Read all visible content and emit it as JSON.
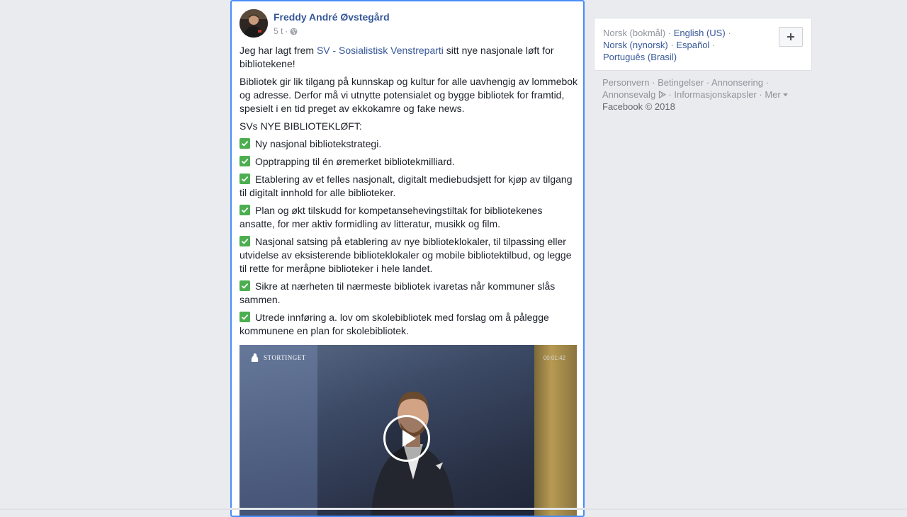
{
  "post": {
    "author": "Freddy André Øvstegård",
    "time": "5 t",
    "time_separator": "·",
    "intro_before": "Jeg har lagt frem ",
    "intro_link": "SV - Sosialistisk Venstreparti",
    "intro_after": " sitt nye nasjonale løft for bibliotekene!",
    "paragraph": "Bibliotek gir lik tilgang på kunnskap og kultur for alle uavhengig av lommebok og adresse. Derfor må vi utnytte potensialet og bygge bibliotek for framtid, spesielt i en tid preget av ekkokamre og fake news.",
    "list_heading": "SVs NYE BIBLIOTEKLØFT:",
    "items": [
      "Ny nasjonal bibliotekstrategi.",
      "Opptrapping til én øremerket bibliotekmilliard.",
      "Etablering av et felles nasjonalt, digitalt mediebudsjett for kjøp av tilgang til digitalt innhold for alle biblioteker.",
      "Plan og økt tilskudd for kompetansehevingstiltak for bibliotekenes ansatte, for mer aktiv formidling av litteratur, musikk og film.",
      "Nasjonal satsing på etablering av nye biblioteklokaler, til tilpassing eller utvidelse av eksisterende biblioteklokaler og mobile bibliotektilbud, og legge til rette for meråpne biblioteker i hele landet.",
      "Sikre at nærheten til nærmeste bibliotek ivaretas når kommuner slås sammen.",
      "Utrede innføring a. lov om skolebibliotek med forslag om å pålegge kommunene en plan for skolebibliotek."
    ],
    "video": {
      "logo_text": "STORTINGET",
      "timecode": "00:01:42"
    }
  },
  "languages": {
    "current": "Norsk (bokmål)",
    "links": [
      "English (US)",
      "Norsk (nynorsk)",
      "Español",
      "Português (Brasil)"
    ],
    "separator": "·"
  },
  "footer": {
    "links": [
      "Personvern",
      "Betingelser",
      "Annonsering",
      "Annonsevalg",
      "Informasjonskapsler",
      "Mer"
    ],
    "copyright": "Facebook © 2018"
  },
  "colors": {
    "link": "#365899",
    "check": "#4bae4f",
    "focus_border": "#4a8df8"
  }
}
